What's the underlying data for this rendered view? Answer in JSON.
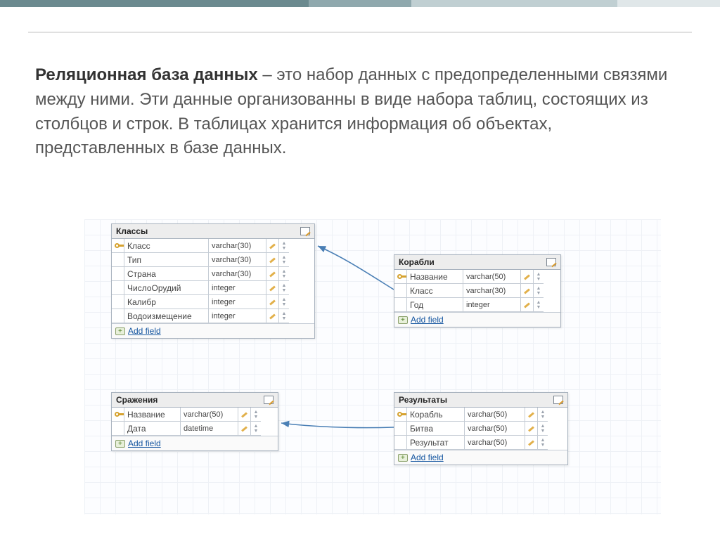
{
  "paragraph": {
    "bold": "Реляционная база данных",
    "rest": " – это набор данных с предопределенными связями между ними. Эти данные организованны в виде набора таблиц, состоящих из столбцов и строк. В таблицах хранится информация об объектах, представленных в базе данных."
  },
  "addFieldLabel": "Add field",
  "tables": {
    "klassy": {
      "title": "Классы",
      "rows": [
        {
          "key": true,
          "name": "Класс",
          "type": "varchar(30)"
        },
        {
          "key": false,
          "name": "Тип",
          "type": "varchar(30)"
        },
        {
          "key": false,
          "name": "Страна",
          "type": "varchar(30)"
        },
        {
          "key": false,
          "name": "ЧислоОрудий",
          "type": "integer"
        },
        {
          "key": false,
          "name": "Калибр",
          "type": "integer"
        },
        {
          "key": false,
          "name": "Водоизмещение",
          "type": "integer"
        }
      ]
    },
    "korabli": {
      "title": "Корабли",
      "rows": [
        {
          "key": true,
          "name": "Название",
          "type": "varchar(50)"
        },
        {
          "key": false,
          "name": "Класс",
          "type": "varchar(30)"
        },
        {
          "key": false,
          "name": "Год",
          "type": "integer"
        }
      ]
    },
    "srazheniya": {
      "title": "Сражения",
      "rows": [
        {
          "key": true,
          "name": "Название",
          "type": "varchar(50)"
        },
        {
          "key": false,
          "name": "Дата",
          "type": "datetime"
        }
      ]
    },
    "rezultaty": {
      "title": "Результаты",
      "rows": [
        {
          "key": true,
          "name": "Корабль",
          "type": "varchar(50)"
        },
        {
          "key": false,
          "name": "Битва",
          "type": "varchar(50)"
        },
        {
          "key": false,
          "name": "Результат",
          "type": "varchar(50)"
        }
      ]
    }
  }
}
